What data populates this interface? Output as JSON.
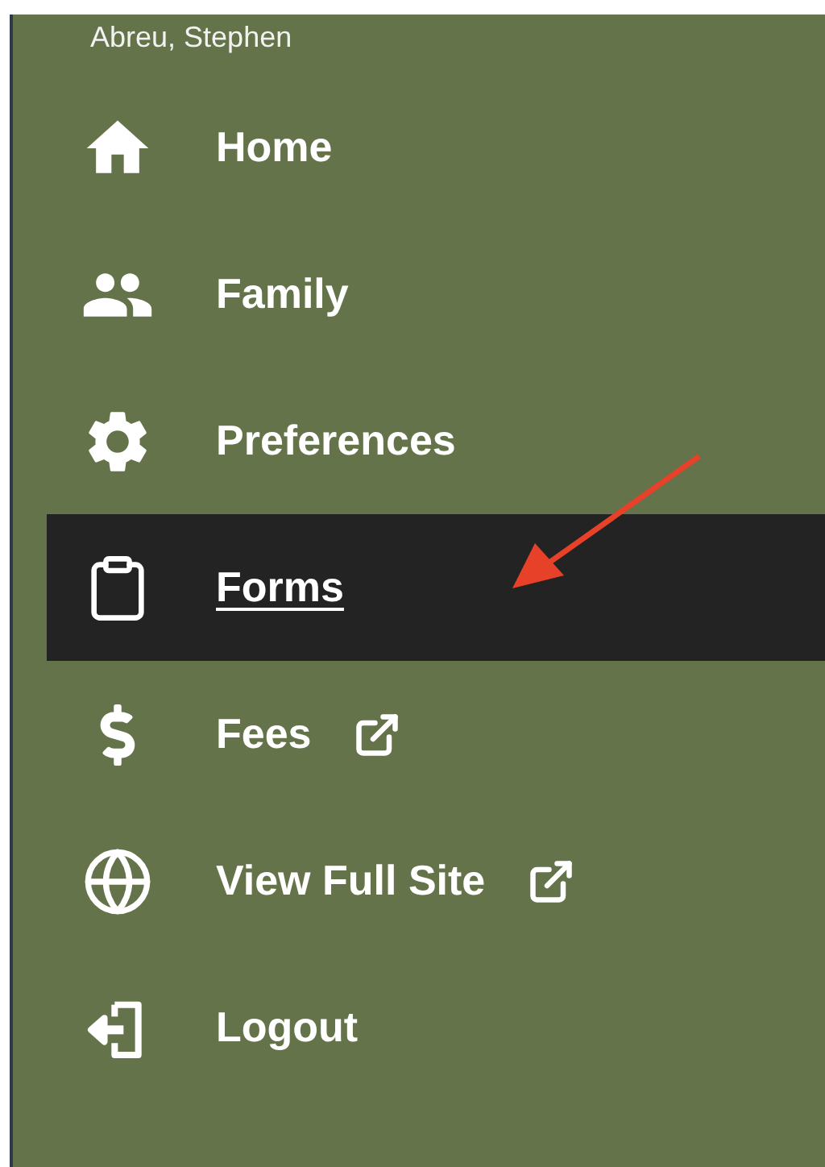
{
  "user_name": "Abreu, Stephen",
  "nav_items": [
    {
      "label": "Home",
      "selected": false,
      "external": false
    },
    {
      "label": "Family",
      "selected": false,
      "external": false
    },
    {
      "label": "Preferences",
      "selected": false,
      "external": false
    },
    {
      "label": "Forms",
      "selected": true,
      "external": false
    },
    {
      "label": "Fees",
      "selected": false,
      "external": true
    },
    {
      "label": "View Full Site",
      "selected": false,
      "external": true
    },
    {
      "label": "Logout",
      "selected": false,
      "external": false
    }
  ]
}
